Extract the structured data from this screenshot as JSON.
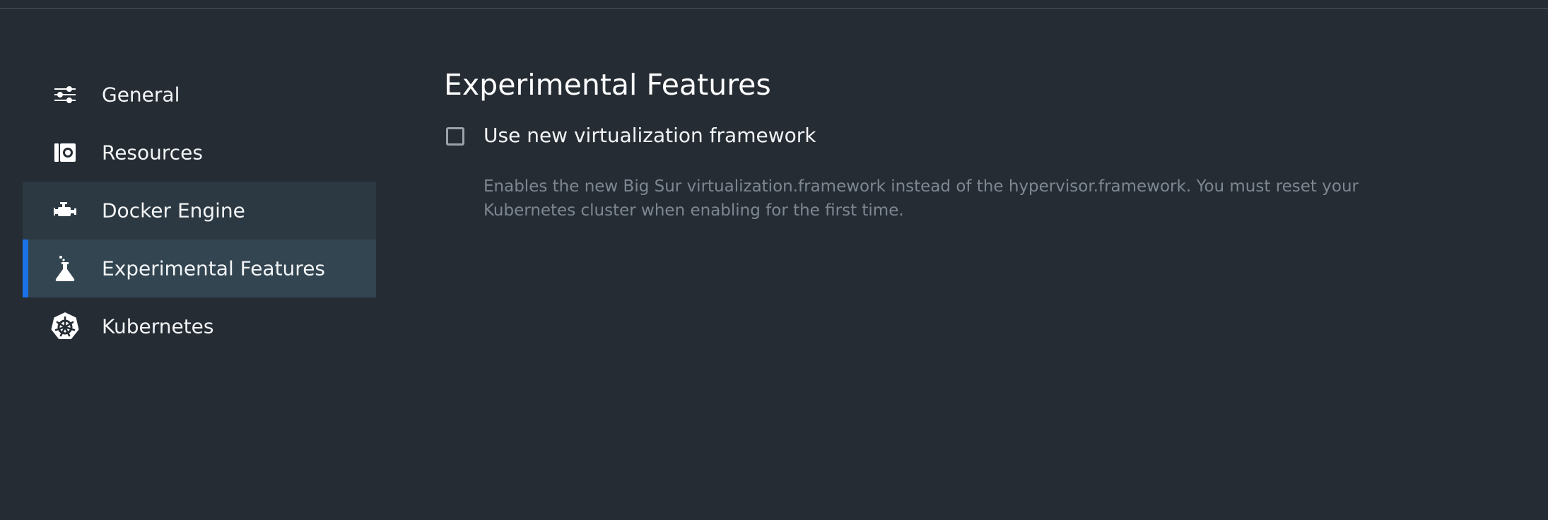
{
  "sidebar": {
    "items": [
      {
        "label": "General",
        "icon": "sliders-icon",
        "state": "normal"
      },
      {
        "label": "Resources",
        "icon": "disk-icon",
        "state": "normal"
      },
      {
        "label": "Docker Engine",
        "icon": "engine-icon",
        "state": "hover"
      },
      {
        "label": "Experimental Features",
        "icon": "flask-icon",
        "state": "active"
      },
      {
        "label": "Kubernetes",
        "icon": "kubernetes-icon",
        "state": "normal"
      }
    ]
  },
  "main": {
    "title": "Experimental Features",
    "options": [
      {
        "label": "Use new virtualization framework",
        "checked": false,
        "description": "Enables the new Big Sur virtualization.framework instead of the hypervisor.framework. You must reset your Kubernetes cluster when enabling for the first time."
      }
    ]
  },
  "colors": {
    "background": "#252c34",
    "active_item": "#324551",
    "hover_item": "#2c3942",
    "accent": "#1b72e8",
    "text": "#f2f4f6",
    "muted_text": "#7e8791"
  }
}
